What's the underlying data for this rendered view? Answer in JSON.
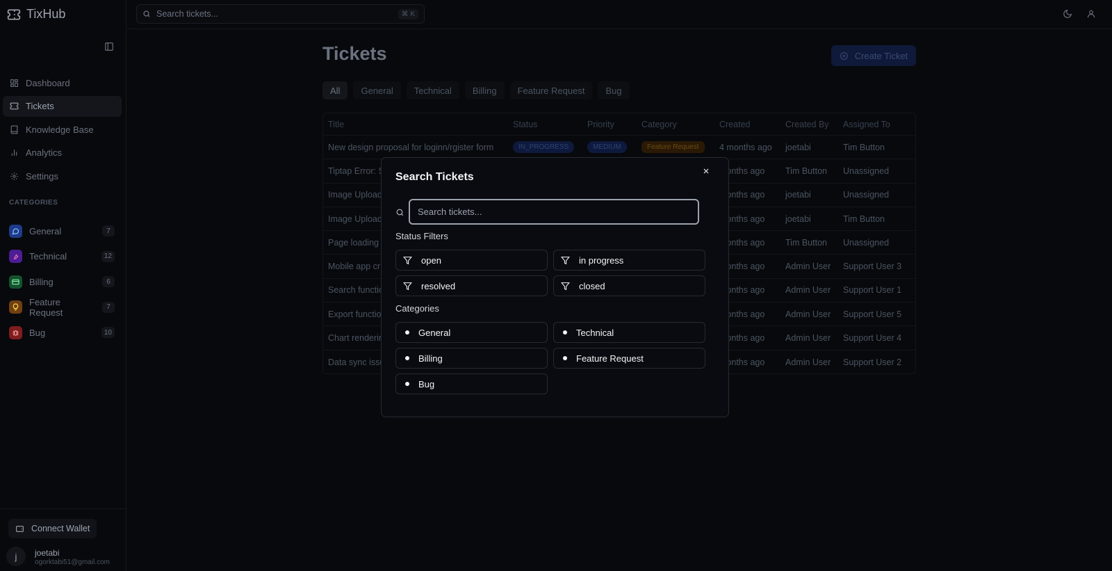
{
  "app": {
    "name": "TixHub"
  },
  "nav": [
    {
      "label": "Dashboard",
      "icon": "dashboard-icon"
    },
    {
      "label": "Tickets",
      "icon": "ticket-icon"
    },
    {
      "label": "Knowledge Base",
      "icon": "book-icon"
    },
    {
      "label": "Analytics",
      "icon": "bar-chart-icon"
    },
    {
      "label": "Settings",
      "icon": "gear-icon"
    }
  ],
  "categories_heading": "CATEGORIES",
  "categories": [
    {
      "label": "General",
      "count": "7",
      "color": "#1e3a8a",
      "icon": "chat-icon"
    },
    {
      "label": "Technical",
      "count": "12",
      "color": "#4c1d95",
      "icon": "wrench-icon"
    },
    {
      "label": "Billing",
      "count": "6",
      "color": "#14532d",
      "icon": "card-icon"
    },
    {
      "label": "Feature Request",
      "count": "7",
      "color": "#713f12",
      "icon": "lightbulb-icon"
    },
    {
      "label": "Bug",
      "count": "10",
      "color": "#7f1d1d",
      "icon": "bug-icon"
    }
  ],
  "footer": {
    "wallet_label": "Connect Wallet",
    "avatar_letter": "j",
    "user_name": "joetabi",
    "user_email": "ogorktabi51@gmail.com"
  },
  "topbar": {
    "search_placeholder": "Search tickets...",
    "shortcut": "⌘ K"
  },
  "page": {
    "title": "Tickets",
    "create_label": "Create Ticket"
  },
  "tabs": [
    "All",
    "General",
    "Technical",
    "Billing",
    "Feature Request",
    "Bug"
  ],
  "table": {
    "headers": [
      "Title",
      "Status",
      "Priority",
      "Category",
      "Created",
      "Created By",
      "Assigned To"
    ],
    "first_row": {
      "title": "New design proposal for loginn/rgister form",
      "status": "IN_PROGRESS",
      "priority": "MEDIUM",
      "category": "Feature Request"
    },
    "rows": [
      {
        "title": "New design proposal for loginn/rgister form",
        "created": "4 months ago",
        "by": "joetabi",
        "assigned": "Tim Button"
      },
      {
        "title": "Tiptap Error: S",
        "created": "months ago",
        "by": "Tim Button",
        "assigned": "Unassigned"
      },
      {
        "title": "Image Upload",
        "created": "months ago",
        "by": "joetabi",
        "assigned": "Unassigned"
      },
      {
        "title": "Image Upload",
        "created": "months ago",
        "by": "joetabi",
        "assigned": "Tim Button"
      },
      {
        "title": "Page loading",
        "created": "months ago",
        "by": "Tim Button",
        "assigned": "Unassigned"
      },
      {
        "title": "Mobile app cr",
        "created": "months ago",
        "by": "Admin User",
        "assigned": "Support User 3"
      },
      {
        "title": "Search functio",
        "created": "months ago",
        "by": "Admin User",
        "assigned": "Support User 1"
      },
      {
        "title": "Export functio",
        "created": "months ago",
        "by": "Admin User",
        "assigned": "Support User 5"
      },
      {
        "title": "Chart renderin",
        "created": "months ago",
        "by": "Admin User",
        "assigned": "Support User 4"
      },
      {
        "title": "Data sync issu",
        "created": "months ago",
        "by": "Admin User",
        "assigned": "Support User 2"
      }
    ]
  },
  "modal": {
    "title": "Search Tickets",
    "input_placeholder": "Search tickets...",
    "status_heading": "Status Filters",
    "statuses": [
      "open",
      "in progress",
      "resolved",
      "closed"
    ],
    "categories_heading": "Categories",
    "categories": [
      "General",
      "Technical",
      "Billing",
      "Feature Request",
      "Bug"
    ]
  }
}
